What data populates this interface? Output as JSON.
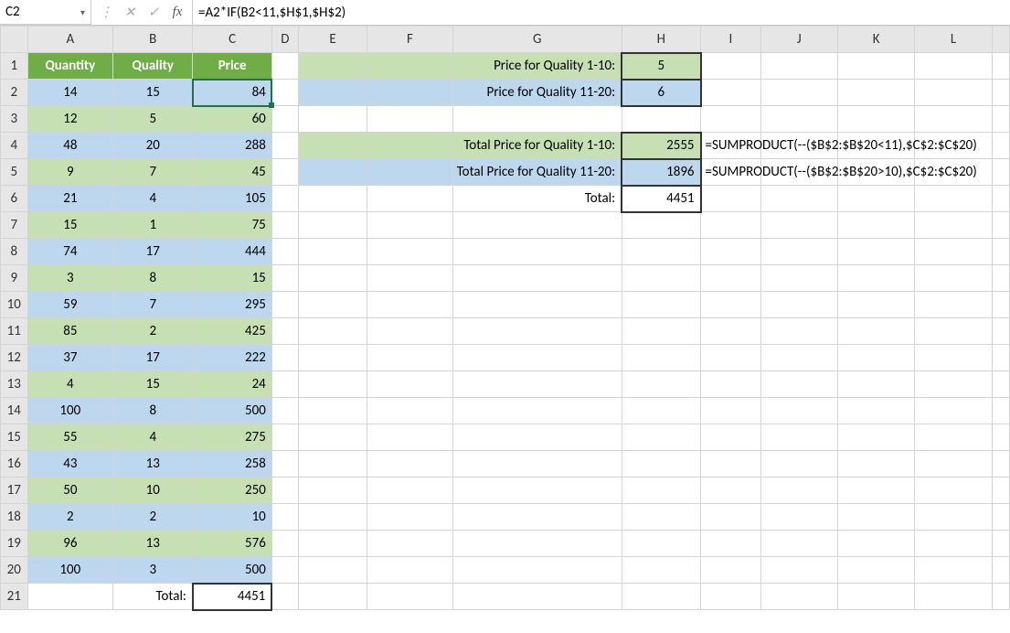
{
  "namebox": "C2",
  "formula": "=A2*IF(B2<11,$H$1,$H$2)",
  "fx_label": "fx",
  "cancel_glyph": "✕",
  "accept_glyph": "✓",
  "dots_glyph": "⋮",
  "col_headers": [
    "A",
    "B",
    "C",
    "D",
    "E",
    "F",
    "G",
    "H",
    "I",
    "J",
    "K",
    "L",
    ""
  ],
  "row_headers": [
    "1",
    "2",
    "3",
    "4",
    "5",
    "6",
    "7",
    "8",
    "9",
    "10",
    "11",
    "12",
    "13",
    "14",
    "15",
    "16",
    "17",
    "18",
    "19",
    "20",
    "21"
  ],
  "headers": {
    "A": "Quantity",
    "B": "Quality",
    "C": "Price"
  },
  "rows": [
    {
      "A": "14",
      "B": "15",
      "C": "84"
    },
    {
      "A": "12",
      "B": "5",
      "C": "60"
    },
    {
      "A": "48",
      "B": "20",
      "C": "288"
    },
    {
      "A": "9",
      "B": "7",
      "C": "45"
    },
    {
      "A": "21",
      "B": "4",
      "C": "105"
    },
    {
      "A": "15",
      "B": "1",
      "C": "75"
    },
    {
      "A": "74",
      "B": "17",
      "C": "444"
    },
    {
      "A": "3",
      "B": "8",
      "C": "15"
    },
    {
      "A": "59",
      "B": "7",
      "C": "295"
    },
    {
      "A": "85",
      "B": "2",
      "C": "425"
    },
    {
      "A": "37",
      "B": "17",
      "C": "222"
    },
    {
      "A": "4",
      "B": "15",
      "C": "24"
    },
    {
      "A": "100",
      "B": "8",
      "C": "500"
    },
    {
      "A": "55",
      "B": "4",
      "C": "275"
    },
    {
      "A": "43",
      "B": "13",
      "C": "258"
    },
    {
      "A": "50",
      "B": "10",
      "C": "250"
    },
    {
      "A": "2",
      "B": "2",
      "C": "10"
    },
    {
      "A": "96",
      "B": "13",
      "C": "576"
    },
    {
      "A": "100",
      "B": "3",
      "C": "500"
    }
  ],
  "total_label": "Total:",
  "total_value": "4451",
  "right": {
    "r1_label": "Price for Quality 1-10:",
    "r1_value": "5",
    "r2_label": "Price for Quality 11-20:",
    "r2_value": "6",
    "r4_label": "Total Price for Quality 1-10:",
    "r4_value": "2555",
    "r4_formula": "=SUMPRODUCT(--($B$2:$B$20<11),$C$2:$C$20)",
    "r5_label": "Total Price for Quality 11-20:",
    "r5_value": "1896",
    "r5_formula": "=SUMPRODUCT(--($B$2:$B$20>10),$C$2:$C$20)",
    "r6_label": "Total:",
    "r6_value": "4451"
  },
  "chart_data": {
    "type": "table",
    "columns": [
      "Quantity",
      "Quality",
      "Price"
    ],
    "data": [
      [
        14,
        15,
        84
      ],
      [
        12,
        5,
        60
      ],
      [
        48,
        20,
        288
      ],
      [
        9,
        7,
        45
      ],
      [
        21,
        4,
        105
      ],
      [
        15,
        1,
        75
      ],
      [
        74,
        17,
        444
      ],
      [
        3,
        8,
        15
      ],
      [
        59,
        7,
        295
      ],
      [
        85,
        2,
        425
      ],
      [
        37,
        17,
        222
      ],
      [
        4,
        15,
        24
      ],
      [
        100,
        8,
        500
      ],
      [
        55,
        4,
        275
      ],
      [
        43,
        13,
        258
      ],
      [
        50,
        10,
        250
      ],
      [
        2,
        2,
        10
      ],
      [
        96,
        13,
        576
      ],
      [
        100,
        3,
        500
      ]
    ],
    "summary": {
      "total": 4451,
      "price_q1_10_unit": 5,
      "price_q11_20_unit": 6,
      "total_price_q1_10": 2555,
      "total_price_q11_20": 1896
    }
  }
}
